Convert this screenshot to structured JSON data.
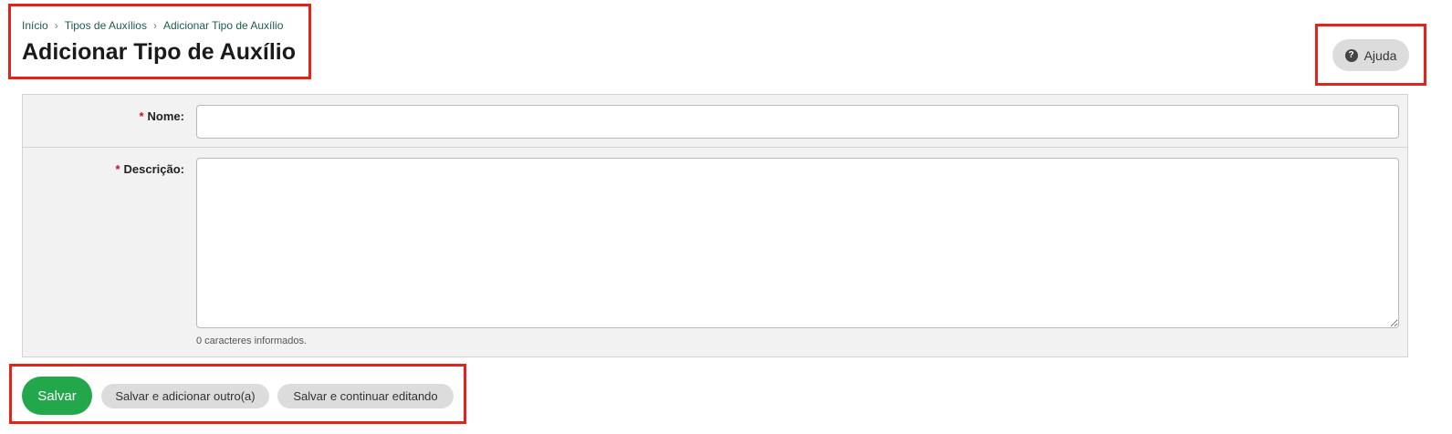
{
  "breadcrumb": {
    "items": [
      "Início",
      "Tipos de Auxílios",
      "Adicionar Tipo de Auxílio"
    ],
    "separator": "›"
  },
  "page": {
    "title": "Adicionar Tipo de Auxílio"
  },
  "help": {
    "label": "Ajuda",
    "icon": "?"
  },
  "form": {
    "required_marker": "*",
    "name": {
      "label": "Nome:",
      "value": "",
      "placeholder": ""
    },
    "description": {
      "label": "Descrição:",
      "value": "",
      "placeholder": "",
      "char_count": "0 caracteres informados."
    }
  },
  "actions": {
    "save": "Salvar",
    "save_add": "Salvar e adicionar outro(a)",
    "save_continue": "Salvar e continuar editando"
  },
  "colors": {
    "primary": "#22a84a",
    "required": "#c0142a",
    "link": "#1d5c4d",
    "highlight": "#e2231a"
  }
}
